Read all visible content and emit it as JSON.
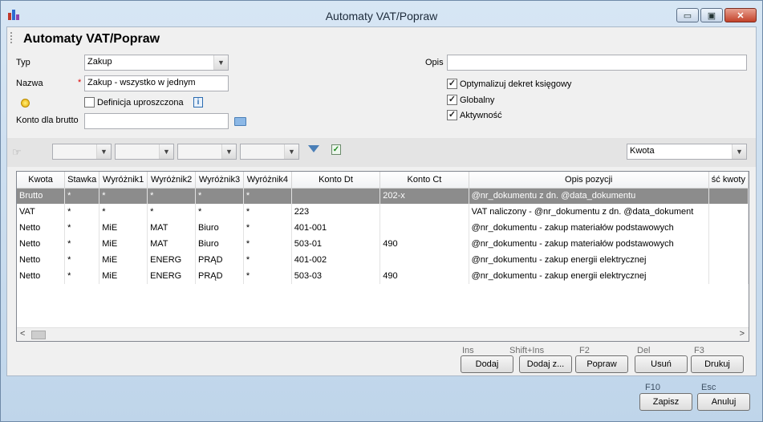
{
  "window": {
    "title": "Automaty VAT/Popraw",
    "minimize_glyph": "▭",
    "maximize_glyph": "▣",
    "close_glyph": "✕"
  },
  "form": {
    "heading": "Automaty VAT/Popraw",
    "typ_label": "Typ",
    "typ_value": "Zakup",
    "nazwa_label": "Nazwa",
    "nazwa_required": "*",
    "nazwa_value": "Zakup - wszystko w jednym",
    "definicja_label": "Definicja uproszczona",
    "definicja_checked": false,
    "konto_brutto_label": "Konto dla brutto",
    "konto_brutto_value": "",
    "opis_label": "Opis",
    "opis_value": "",
    "optymalizuj_label": "Optymalizuj dekret księgowy",
    "optymalizuj_checked": true,
    "globalny_label": "Globalny",
    "globalny_checked": true,
    "aktywnosc_label": "Aktywność",
    "aktywnosc_checked": true
  },
  "filter": {
    "kwota_select": "Kwota"
  },
  "grid": {
    "columns": [
      "Kwota",
      "Stawka",
      "Wyróżnik1",
      "Wyróżnik2",
      "Wyróżnik3",
      "Wyróżnik4",
      "Konto Dt",
      "Konto Ct",
      "Opis pozycji",
      "ść kwoty"
    ],
    "rows": [
      [
        "Brutto",
        "*",
        "*",
        "*",
        "*",
        "*",
        "",
        "202-x",
        "@nr_dokumentu z dn. @data_dokumentu",
        ""
      ],
      [
        "VAT",
        "*",
        "*",
        "*",
        "*",
        "*",
        "223",
        "",
        "VAT naliczony - @nr_dokumentu z dn. @data_dokument",
        ""
      ],
      [
        "Netto",
        "*",
        "MiE",
        "MAT",
        "Biuro",
        "*",
        "401-001",
        "",
        "@nr_dokumentu - zakup materiałów podstawowych",
        ""
      ],
      [
        "Netto",
        "*",
        "MiE",
        "MAT",
        "Biuro",
        "*",
        "503-01",
        "490",
        "@nr_dokumentu - zakup materiałów podstawowych",
        ""
      ],
      [
        "Netto",
        "*",
        "MiE",
        "ENERG",
        "PRĄD",
        "*",
        "401-002",
        "",
        "@nr_dokumentu - zakup energii elektrycznej",
        ""
      ],
      [
        "Netto",
        "*",
        "MiE",
        "ENERG",
        "PRĄD",
        "*",
        "503-03",
        "490",
        "@nr_dokumentu - zakup energii elektrycznej",
        ""
      ]
    ],
    "selected_row": 0,
    "scroll_left": "<",
    "scroll_right": ">"
  },
  "actions": [
    {
      "key": "Ins",
      "label": "Dodaj"
    },
    {
      "key": "Shift+Ins",
      "label": "Dodaj z..."
    },
    {
      "key": "F2",
      "label": "Popraw"
    },
    {
      "key": "Del",
      "label": "Usuń"
    },
    {
      "key": "F3",
      "label": "Drukuj"
    }
  ],
  "footer": {
    "save_key": "F10",
    "save_label": "Zapisz",
    "cancel_key": "Esc",
    "cancel_label": "Anuluj"
  },
  "colors": {
    "selected_row": "#8c8c8c",
    "accent": "#1c6fbf"
  }
}
